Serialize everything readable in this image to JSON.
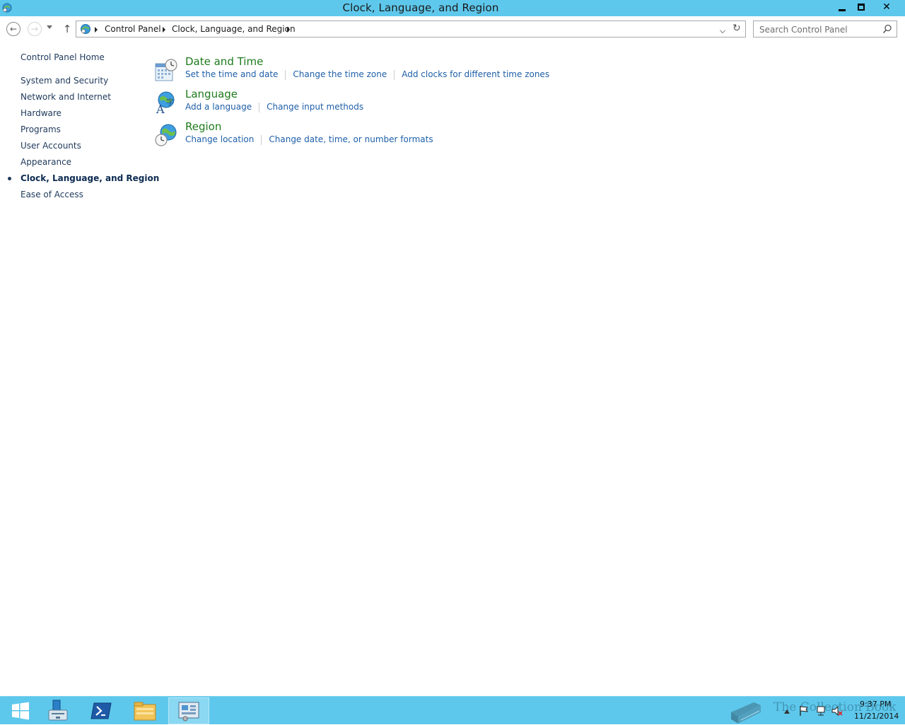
{
  "window": {
    "title": "Clock, Language, and Region"
  },
  "nav": {
    "breadcrumbs": [
      "Control Panel",
      "Clock, Language, and Region"
    ],
    "search_placeholder": "Search Control Panel"
  },
  "sidebar": {
    "home": "Control Panel Home",
    "items": [
      {
        "label": "System and Security",
        "active": false
      },
      {
        "label": "Network and Internet",
        "active": false
      },
      {
        "label": "Hardware",
        "active": false
      },
      {
        "label": "Programs",
        "active": false
      },
      {
        "label": "User Accounts",
        "active": false
      },
      {
        "label": "Appearance",
        "active": false
      },
      {
        "label": "Clock, Language, and Region",
        "active": true
      },
      {
        "label": "Ease of Access",
        "active": false
      }
    ]
  },
  "categories": [
    {
      "title": "Date and Time",
      "icon": "calendar-clock-icon",
      "links": [
        "Set the time and date",
        "Change the time zone",
        "Add clocks for different time zones"
      ]
    },
    {
      "title": "Language",
      "icon": "language-globe-icon",
      "links": [
        "Add a language",
        "Change input methods"
      ]
    },
    {
      "title": "Region",
      "icon": "region-globe-clock-icon",
      "links": [
        "Change location",
        "Change date, time, or number formats"
      ]
    }
  ],
  "taskbar": {
    "items": [
      "start-button",
      "server-manager",
      "powershell",
      "file-explorer",
      "control-panel"
    ],
    "clock_time": "9:37 PM",
    "clock_date": "11/21/2014",
    "watermark": "The Collection Book"
  },
  "colors": {
    "chrome": "#5ec8ec",
    "link": "#1e5fa8",
    "category_title": "#1e7a1e",
    "nav_text": "#1e395b"
  }
}
